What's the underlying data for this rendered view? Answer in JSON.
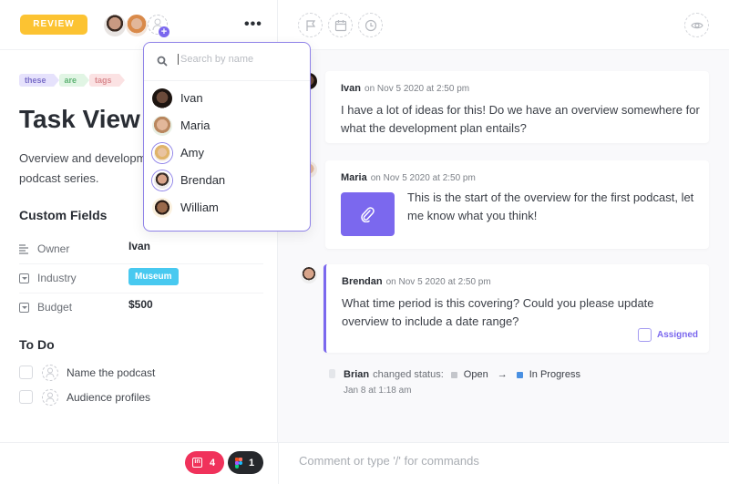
{
  "header": {
    "status_label": "REVIEW",
    "assignees": [
      "Ivan",
      "Maria"
    ],
    "more_label": "•••"
  },
  "task": {
    "tags": [
      "these",
      "are",
      "tags"
    ],
    "title": "Task View",
    "description": "Overview and development plan for the original podcast series."
  },
  "custom_fields": {
    "title": "Custom Fields",
    "rows": [
      {
        "label": "Owner",
        "value": "Ivan",
        "icon": "text-lines-icon"
      },
      {
        "label": "Industry",
        "value": "Museum",
        "icon": "dropdown-icon",
        "badge_color": "#48c9f0"
      },
      {
        "label": "Budget",
        "value": "$500",
        "icon": "dropdown-icon"
      }
    ]
  },
  "todo": {
    "title": "To Do",
    "items": [
      {
        "text": "Name the podcast",
        "checked": false
      },
      {
        "text": "Audience profiles",
        "checked": false
      }
    ]
  },
  "dropdown": {
    "search_placeholder": "Search by name",
    "search_value": "",
    "people": [
      {
        "name": "Ivan",
        "selected": false
      },
      {
        "name": "Maria",
        "selected": false
      },
      {
        "name": "Amy",
        "selected": true
      },
      {
        "name": "Brendan",
        "selected": true
      },
      {
        "name": "William",
        "selected": false
      }
    ]
  },
  "toolbar_right": {
    "icons": [
      "flag-icon",
      "calendar-icon",
      "clock-icon",
      "eye-icon"
    ]
  },
  "comments": [
    {
      "author": "Ivan",
      "time": "on Nov 5 2020 at 2:50 pm",
      "text": "I have a lot of ideas for this! Do we have an overview somewhere for what the development plan entails?"
    },
    {
      "author": "Maria",
      "time": "on Nov 5 2020 at 2:50 pm",
      "text": "This is the start of the overview for the first podcast, let me know what you think!",
      "has_attachment": true
    },
    {
      "author": "Brendan",
      "time": "on Nov 5 2020 at 2:50 pm",
      "text": "What time period is this covering? Could you please update overview to include a date range?",
      "assigned_label": "Assigned"
    }
  ],
  "activity": {
    "user": "Brian",
    "action": "changed status:",
    "from": "Open",
    "from_color": "#c4c6cb",
    "arrow": "→",
    "to": "In Progress",
    "to_color": "#4a90e2",
    "time": "Jan 8 at 1:18 am"
  },
  "bottom": {
    "invision_count": "4",
    "figma_count": "1",
    "comment_placeholder": "Comment or type '/' for commands",
    "comment_value": ""
  },
  "colors": {
    "accent": "#7b68ee",
    "status_review": "#fcc332",
    "invision": "#f0325b",
    "figma_pill": "#26282c"
  }
}
